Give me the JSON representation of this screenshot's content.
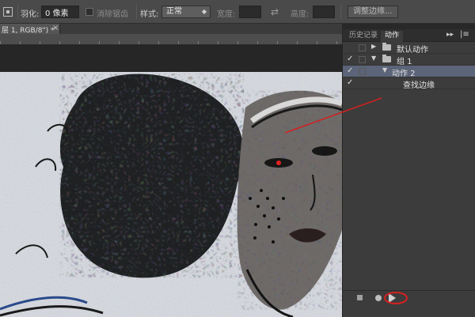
{
  "options_bar": {
    "feather_label": "羽化:",
    "feather_value": "0 像素",
    "antialias_label": "消除锯齿",
    "style_label": "样式:",
    "style_value": "正常",
    "width_label": "宽度:",
    "height_label": "高度:",
    "refine_edge_label": "调整边缘..."
  },
  "document_tab": {
    "title": "层 1, RGB/8\") *"
  },
  "panel": {
    "tabs": [
      {
        "label": "历史记录",
        "active": false
      },
      {
        "label": "动作",
        "active": true
      }
    ],
    "rows": [
      {
        "label": "默认动作",
        "checked": false,
        "type": "set",
        "expanded": false,
        "selected": false
      },
      {
        "label": "组 1",
        "checked": true,
        "type": "set",
        "expanded": true,
        "selected": false
      },
      {
        "label": "动作 2",
        "checked": true,
        "type": "action",
        "expanded": true,
        "selected": true
      },
      {
        "label": "查找边缘",
        "checked": true,
        "type": "step",
        "expanded": false,
        "selected": false
      }
    ]
  },
  "colors": {
    "annotation": "#d42020",
    "selection": "#5b6478",
    "panel_bg": "#3c3c3c",
    "options_bg": "#4a4a4a"
  },
  "icons": [
    "marquee-tool-icon",
    "swap-icon",
    "close-icon",
    "collapse-icon",
    "panel-menu-icon",
    "check-icon",
    "triangle-icon",
    "folder-icon",
    "stop-icon",
    "record-icon",
    "play-icon"
  ]
}
